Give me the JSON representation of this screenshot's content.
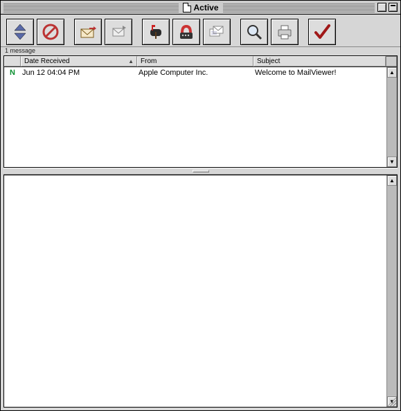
{
  "window": {
    "title": "Active"
  },
  "toolbar": {
    "icons": {
      "sort": "sort-icon",
      "junk": "no-symbol-icon",
      "reply": "reply-envelope-icon",
      "forward": "forward-envelope-icon",
      "mailbox": "mailbox-icon",
      "addressbook": "phone-rolodex-icon",
      "compose": "compose-letters-icon",
      "search": "magnifier-icon",
      "print": "printer-icon",
      "mark": "checkmark-icon"
    }
  },
  "status": {
    "message_count_text": "1 message"
  },
  "columns": {
    "status": "",
    "date": "Date Received",
    "from": "From",
    "subject": "Subject",
    "sort_indicator": "▲"
  },
  "messages": [
    {
      "status_glyph": "N",
      "date": "Jun 12  04:04 PM",
      "from": "Apple Computer Inc.",
      "subject": "Welcome to MailViewer!"
    }
  ],
  "colors": {
    "accent_unread": "#0a8f2f"
  }
}
